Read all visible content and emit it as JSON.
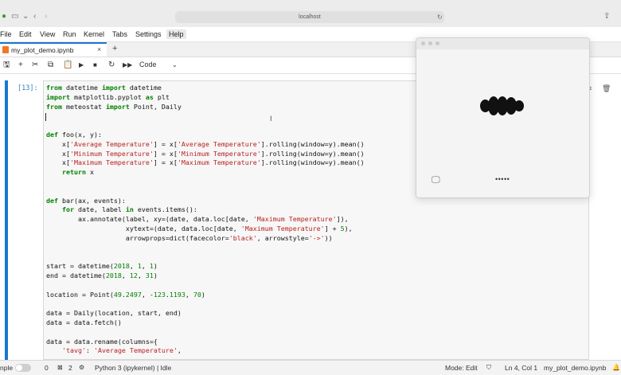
{
  "browser": {
    "url": "localhost"
  },
  "menu": {
    "items": [
      "File",
      "Edit",
      "View",
      "Run",
      "Kernel",
      "Tabs",
      "Settings",
      "Help"
    ]
  },
  "tab": {
    "title": "my_plot_demo.ipynb"
  },
  "toolbar": {
    "cell_type": "Code"
  },
  "cell": {
    "prompt": "[13]:",
    "lines": [
      "from datetime import datetime",
      "import matplotlib.pyplot as plt",
      "from meteostat import Point, Daily",
      "",
      "",
      "def foo(x, y):",
      "    x['Average Temperature'] = x['Average Temperature'].rolling(window=y).mean()",
      "    x['Minimum Temperature'] = x['Minimum Temperature'].rolling(window=y).mean()",
      "    x['Maximum Temperature'] = x['Maximum Temperature'].rolling(window=y).mean()",
      "    return x",
      "",
      "",
      "def bar(ax, events):",
      "    for date, label in events.items():",
      "        ax.annotate(label, xy=(date, data.loc[date, 'Maximum Temperature']),",
      "                    xytext=(date, data.loc[date, 'Maximum Temperature'] + 5),",
      "                    arrowprops=dict(facecolor='black', arrowstyle='->'))",
      "",
      "",
      "start = datetime(2018, 1, 1)",
      "end = datetime(2018, 12, 31)",
      "",
      "location = Point(49.2497, -123.1193, 70)",
      "",
      "data = Daily(location, start, end)",
      "data = data.fetch()",
      "",
      "data = data.rename(columns={",
      "    'tavg': 'Average Temperature',"
    ]
  },
  "status": {
    "mode_label": "nple",
    "count_a": "0",
    "count_b": "2",
    "kernel": "Python 3 (ipykernel) | Idle",
    "mode": "Mode: Edit",
    "position": "Ln 4, Col 1",
    "file": "my_plot_demo.ipynb"
  },
  "overlay": {
    "dots": "•••••"
  },
  "colors": {
    "accent": "#1976d2",
    "prompt": "#307fc1"
  }
}
